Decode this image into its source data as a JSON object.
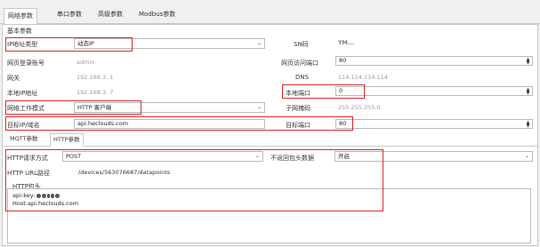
{
  "tabs": [
    "网络参数",
    "串口参数",
    "高级参数",
    "Modbus参数"
  ],
  "group_title": "基本参数",
  "left": {
    "ip_type": {
      "label": "IP地址类型",
      "value": "动态IP"
    },
    "login": {
      "label": "网页登录账号",
      "value": "admin"
    },
    "gateway": {
      "label": "网关",
      "value": "192.168.3.  1"
    },
    "local_ip": {
      "label": "本地IP地址",
      "value": "192.168.3.  7"
    },
    "work_mode": {
      "label": "网络工作模式",
      "value": "HTTP 客户端"
    },
    "target": {
      "label": "目标IP/域名",
      "value": "api.heclouds.com"
    }
  },
  "right": {
    "sn": {
      "label": "SN码",
      "value": "TM..."
    },
    "web_port": {
      "label": "网页访问端口",
      "value": "80"
    },
    "dns": {
      "label": "DNS",
      "value": "114.114.114.114"
    },
    "local_port": {
      "label": "本地端口",
      "value": "0"
    },
    "subnet": {
      "label": "子网掩码",
      "value": "255.255.255.0"
    },
    "target_port": {
      "label": "目标端口",
      "value": "80"
    }
  },
  "subtabs": [
    "MQTT参数",
    "HTTP参数"
  ],
  "http": {
    "method": {
      "label": "HTTP请求方式",
      "value": "POST"
    },
    "no_header": {
      "label": "不返回包头数据",
      "value": "开启"
    },
    "url": {
      "label": "HTTP URL路径",
      "value": "/devices/563076687/datapoints"
    },
    "header_label": "HTTP包头",
    "header_line1": "api-key:",
    "header_line2": "Host:api.heclouds.com"
  }
}
